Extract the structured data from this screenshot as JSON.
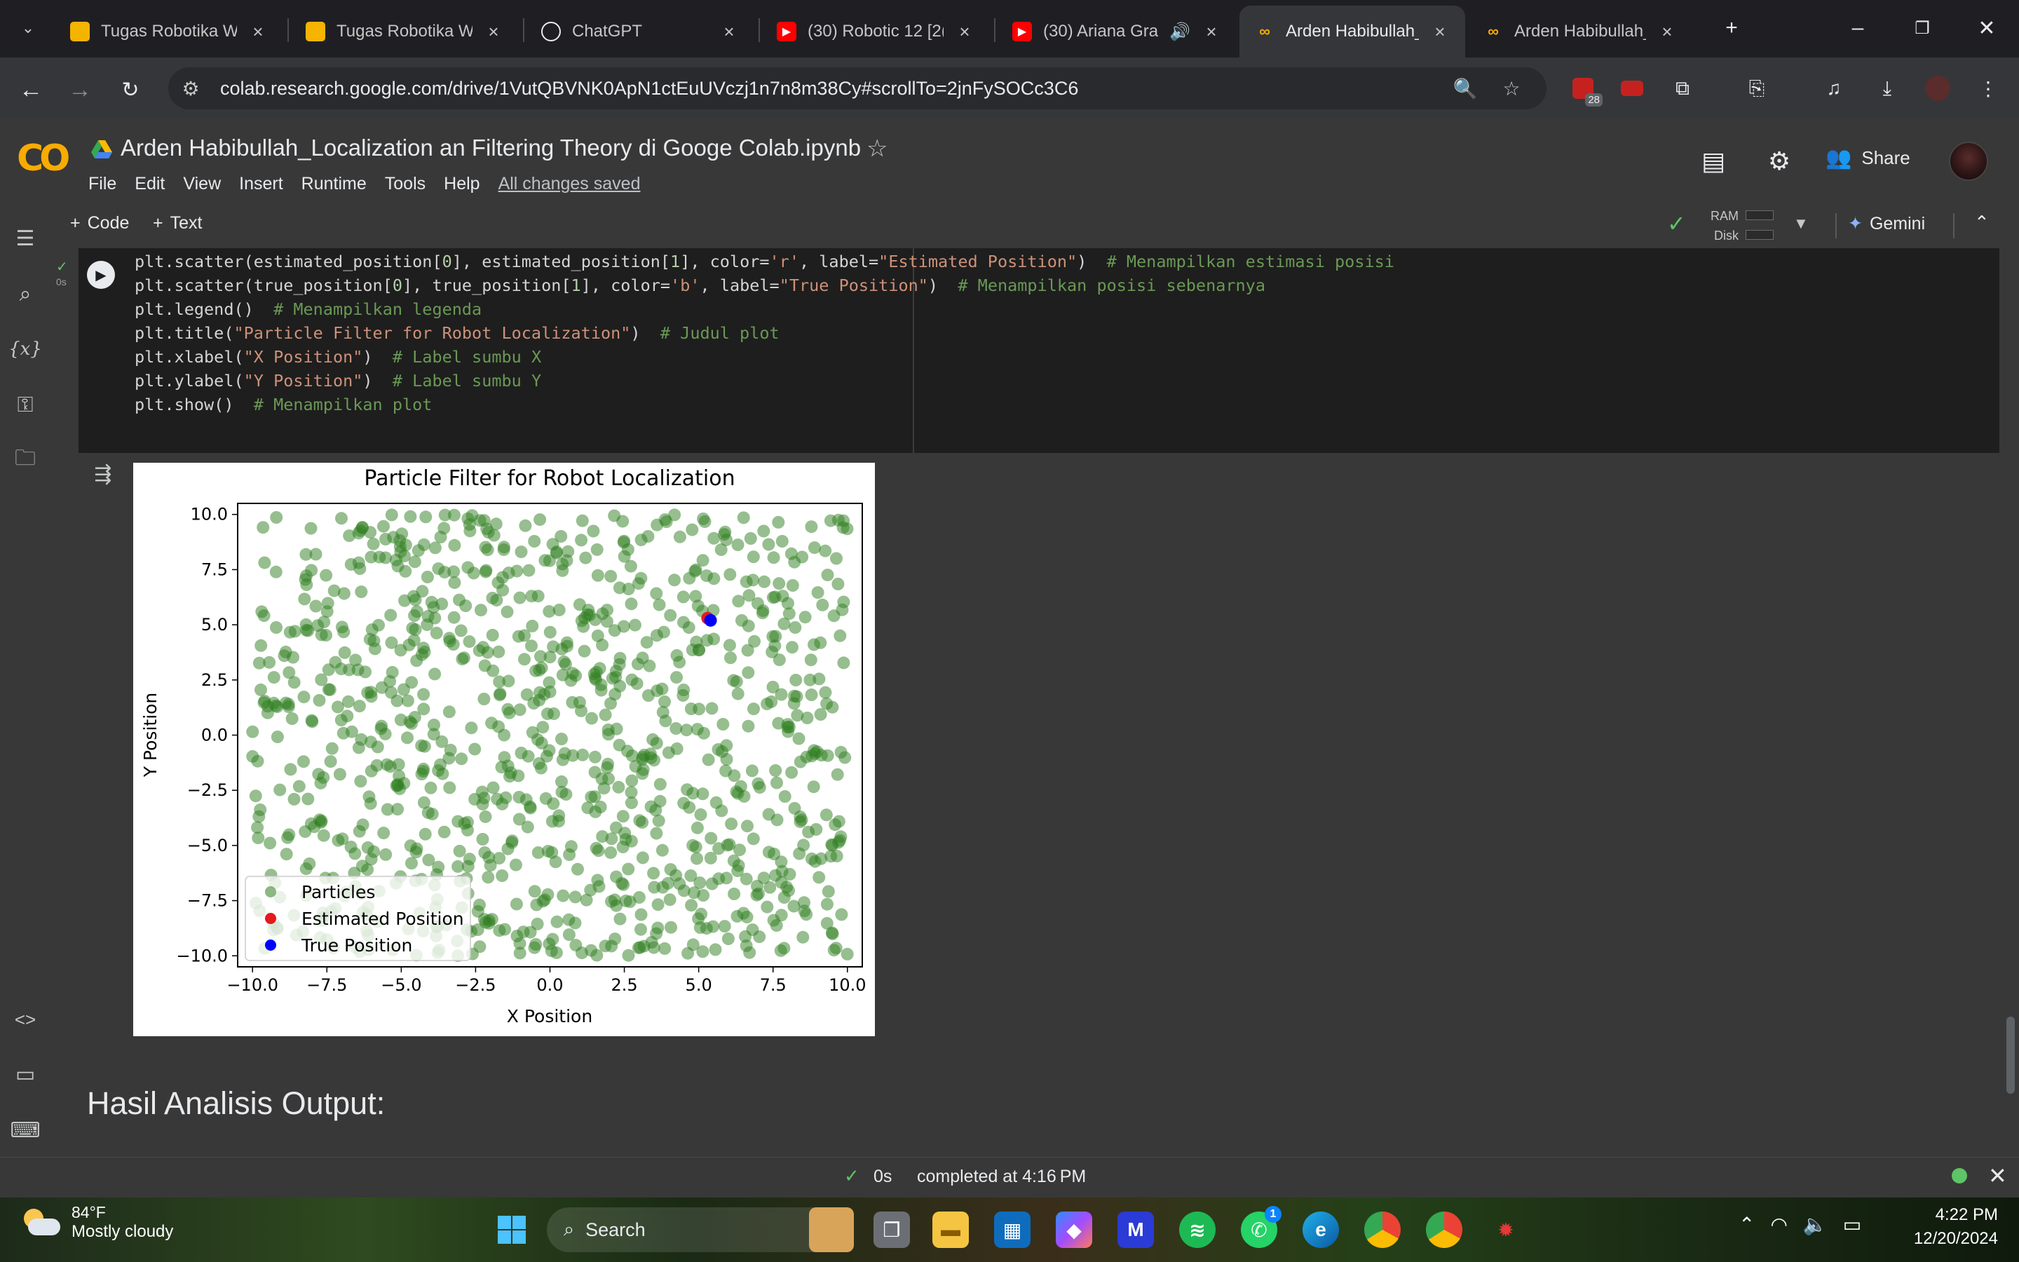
{
  "browser": {
    "tabs": [
      {
        "title": "Tugas Robotika W",
        "icon": "google-slides-icon",
        "active": false
      },
      {
        "title": "Tugas Robotika W",
        "icon": "google-slides-icon",
        "active": false
      },
      {
        "title": "ChatGPT",
        "icon": "chatgpt-icon",
        "active": false
      },
      {
        "title": "(30) Robotic 12 [2(",
        "icon": "youtube-icon",
        "active": false
      },
      {
        "title": "(30) Ariana Gra",
        "icon": "youtube-icon",
        "active": false
      },
      {
        "title": "Arden Habibullah_",
        "icon": "colab-icon",
        "active": true
      },
      {
        "title": "Arden Habibullah_",
        "icon": "colab-icon",
        "active": false
      }
    ],
    "url": "colab.research.google.com/drive/1VutQBVNK0ApN1ctEuUVczj1n7n8m38Cy#scrollTo=2jnFySOCc3C6",
    "extension_badge": "28"
  },
  "colab": {
    "notebook_title": "Arden Habibullah_Localization an Filtering Theory di Googe Colab.ipynb",
    "menu": [
      "File",
      "Edit",
      "View",
      "Insert",
      "Runtime",
      "Tools",
      "Help"
    ],
    "saved_status": "All changes saved",
    "share_label": "Share",
    "add_code_label": "Code",
    "add_text_label": "Text",
    "ram_label": "RAM",
    "disk_label": "Disk",
    "gemini_label": "Gemini",
    "exec_time": "0s"
  },
  "code_lines": [
    "plt.scatter(estimated_position[0], estimated_position[1], color='r', label=\"Estimated Position\")  # Menampilkan estimasi posisi",
    "plt.scatter(true_position[0], true_position[1], color='b', label=\"True Position\")  # Menampilkan posisi sebenarnya",
    "plt.legend()  # Menampilkan legenda",
    "plt.title(\"Particle Filter for Robot Localization\")  # Judul plot",
    "plt.xlabel(\"X Position\")  # Label sumbu X",
    "plt.ylabel(\"Y Position\")  # Label sumbu Y",
    "plt.show()  # Menampilkan plot"
  ],
  "chart_data": {
    "type": "scatter",
    "title": "Particle Filter for Robot Localization",
    "xlabel": "X Position",
    "ylabel": "Y Position",
    "xlim": [
      -10.5,
      10.5
    ],
    "ylim": [
      -10.5,
      10.5
    ],
    "xticks": [
      -10.0,
      -7.5,
      -5.0,
      -2.5,
      0.0,
      2.5,
      5.0,
      7.5,
      10.0
    ],
    "yticks": [
      -10.0,
      -7.5,
      -5.0,
      -2.5,
      0.0,
      2.5,
      5.0,
      7.5,
      10.0
    ],
    "xtick_labels": [
      "−10.0",
      "−7.5",
      "−5.0",
      "−2.5",
      "0.0",
      "2.5",
      "5.0",
      "7.5",
      "10.0"
    ],
    "ytick_labels": [
      "−10.0",
      "−7.5",
      "−5.0",
      "−2.5",
      "0.0",
      "2.5",
      "5.0",
      "7.5",
      "10.0"
    ],
    "legend_position": "lower-left",
    "series": [
      {
        "name": "Particles",
        "color": "#2e7d1e",
        "alpha": 0.5,
        "count": 1000,
        "distribution": "uniform",
        "range": [
          -10,
          10
        ]
      },
      {
        "name": "Estimated Position",
        "color": "#e41a1c",
        "points": [
          [
            5.3,
            5.3
          ]
        ]
      },
      {
        "name": "True Position",
        "color": "#0000ff",
        "points": [
          [
            5.4,
            5.2
          ]
        ]
      }
    ]
  },
  "markdown_heading": "Hasil Analisis Output:",
  "status": {
    "duration": "0s",
    "message": "completed at 4:16 PM"
  },
  "taskbar": {
    "weather_temp": "84°F",
    "weather_desc": "Mostly cloudy",
    "search_label": "Search",
    "time": "4:22 PM",
    "date": "12/20/2024",
    "whatsapp_badge": "1"
  }
}
